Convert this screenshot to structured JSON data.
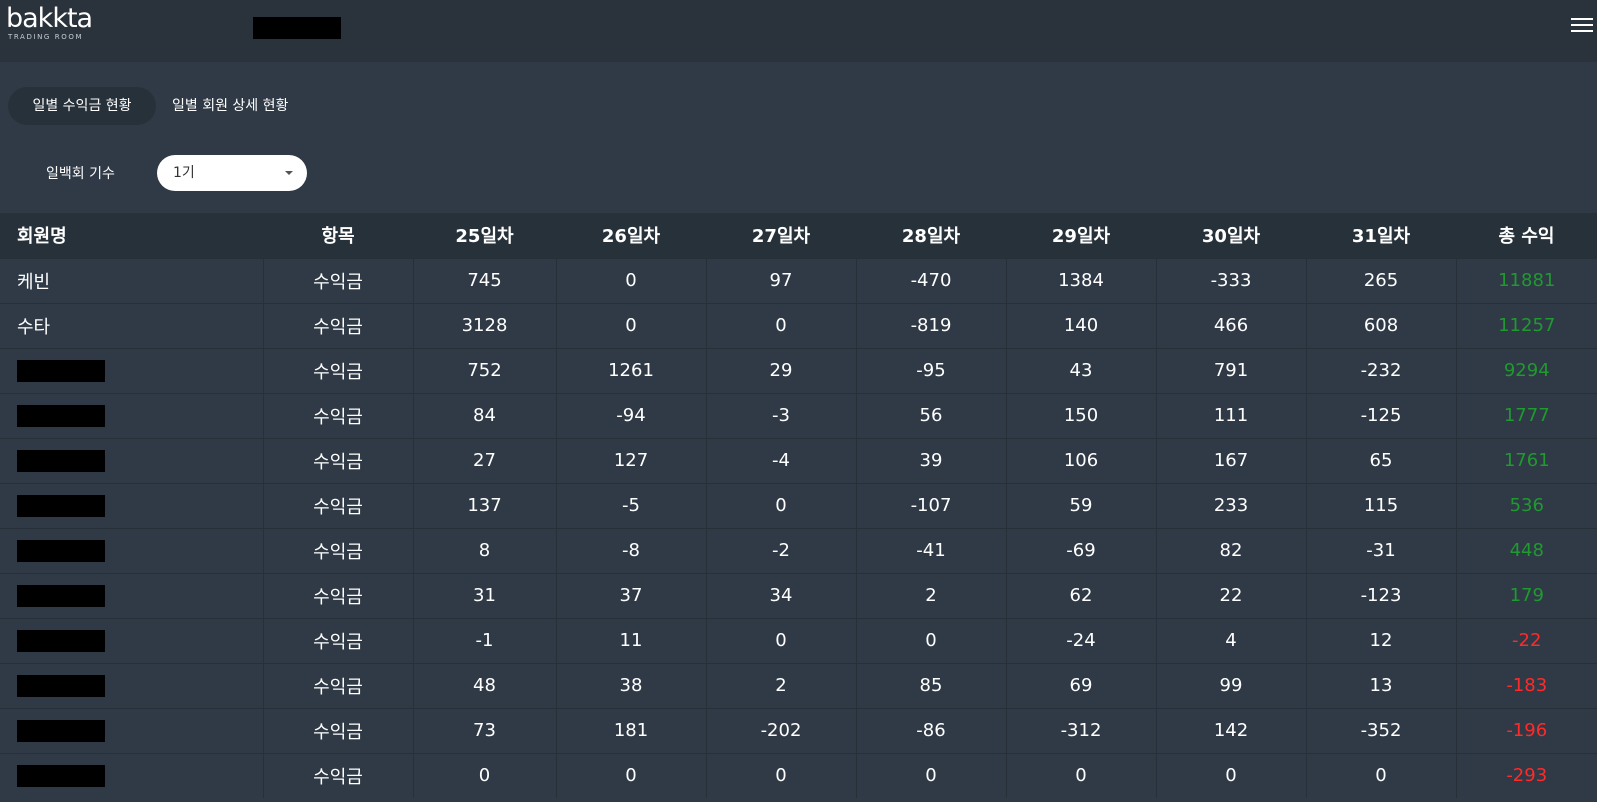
{
  "header": {
    "logo_main": "bakkta",
    "logo_sub": "TRADING ROOM"
  },
  "tabs": [
    {
      "label": "일별 수익금 현황",
      "active": true
    },
    {
      "label": "일별 회원 상세 현황",
      "active": false
    }
  ],
  "filter": {
    "label": "일백회 기수",
    "selected": "1기"
  },
  "table": {
    "columns": [
      "회원명",
      "항목",
      "25일차",
      "26일차",
      "27일차",
      "28일차",
      "29일차",
      "30일차",
      "31일차",
      "총 수익"
    ],
    "rows": [
      {
        "name": "케빈",
        "redacted": false,
        "item": "수익금",
        "d25": "745",
        "d26": "0",
        "d27": "97",
        "d28": "-470",
        "d29": "1384",
        "d30": "-333",
        "d31": "265",
        "total": "11881",
        "total_sign": "pos"
      },
      {
        "name": "수타",
        "redacted": false,
        "item": "수익금",
        "d25": "3128",
        "d26": "0",
        "d27": "0",
        "d28": "-819",
        "d29": "140",
        "d30": "466",
        "d31": "608",
        "total": "11257",
        "total_sign": "pos"
      },
      {
        "name": "",
        "redacted": true,
        "item": "수익금",
        "d25": "752",
        "d26": "1261",
        "d27": "29",
        "d28": "-95",
        "d29": "43",
        "d30": "791",
        "d31": "-232",
        "total": "9294",
        "total_sign": "pos"
      },
      {
        "name": "",
        "redacted": true,
        "item": "수익금",
        "d25": "84",
        "d26": "-94",
        "d27": "-3",
        "d28": "56",
        "d29": "150",
        "d30": "111",
        "d31": "-125",
        "total": "1777",
        "total_sign": "pos"
      },
      {
        "name": "",
        "redacted": true,
        "item": "수익금",
        "d25": "27",
        "d26": "127",
        "d27": "-4",
        "d28": "39",
        "d29": "106",
        "d30": "167",
        "d31": "65",
        "total": "1761",
        "total_sign": "pos"
      },
      {
        "name": "",
        "redacted": true,
        "item": "수익금",
        "d25": "137",
        "d26": "-5",
        "d27": "0",
        "d28": "-107",
        "d29": "59",
        "d30": "233",
        "d31": "115",
        "total": "536",
        "total_sign": "pos"
      },
      {
        "name": "",
        "redacted": true,
        "item": "수익금",
        "d25": "8",
        "d26": "-8",
        "d27": "-2",
        "d28": "-41",
        "d29": "-69",
        "d30": "82",
        "d31": "-31",
        "total": "448",
        "total_sign": "pos"
      },
      {
        "name": "",
        "redacted": true,
        "item": "수익금",
        "d25": "31",
        "d26": "37",
        "d27": "34",
        "d28": "2",
        "d29": "62",
        "d30": "22",
        "d31": "-123",
        "total": "179",
        "total_sign": "pos"
      },
      {
        "name": "",
        "redacted": true,
        "item": "수익금",
        "d25": "-1",
        "d26": "11",
        "d27": "0",
        "d28": "0",
        "d29": "-24",
        "d30": "4",
        "d31": "12",
        "total": "-22",
        "total_sign": "neg"
      },
      {
        "name": "",
        "redacted": true,
        "item": "수익금",
        "d25": "48",
        "d26": "38",
        "d27": "2",
        "d28": "85",
        "d29": "69",
        "d30": "99",
        "d31": "13",
        "total": "-183",
        "total_sign": "neg"
      },
      {
        "name": "",
        "redacted": true,
        "item": "수익금",
        "d25": "73",
        "d26": "181",
        "d27": "-202",
        "d28": "-86",
        "d29": "-312",
        "d30": "142",
        "d31": "-352",
        "total": "-196",
        "total_sign": "neg"
      },
      {
        "name": "",
        "redacted": true,
        "item": "수익금",
        "d25": "0",
        "d26": "0",
        "d27": "0",
        "d28": "0",
        "d29": "0",
        "d30": "0",
        "d31": "0",
        "total": "-293",
        "total_sign": "neg"
      }
    ]
  },
  "colors": {
    "background": "#2f3a46",
    "header_bg": "#27313a",
    "positive": "#1f9a2f",
    "negative": "#ff2a2a"
  }
}
